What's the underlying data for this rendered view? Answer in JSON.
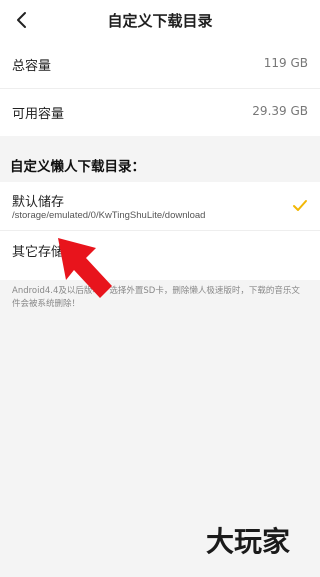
{
  "header": {
    "title": "自定义下载目录"
  },
  "storage": {
    "total_label": "总容量",
    "total_value": "119 GB",
    "available_label": "可用容量",
    "available_value": "29.39 GB"
  },
  "section": {
    "title": "自定义懒人下载目录："
  },
  "options": [
    {
      "title": "默认储存",
      "path": "/storage/emulated/0/KwTingShuLite/download",
      "selected": true
    },
    {
      "title": "其它存储",
      "selected": false
    }
  ],
  "note": "Android4.4及以后版本，选择外置SD卡，删除懒人极速版时，下载的音乐文件会被系统删除！",
  "colors": {
    "check": "#f2b705",
    "arrow": "#e8141c",
    "background": "#f4f4f4"
  },
  "icons": {
    "back": "chevron-left-icon",
    "check": "check-icon",
    "arrow": "pointer-arrow-icon"
  },
  "watermark": {
    "text": "大玩家"
  }
}
